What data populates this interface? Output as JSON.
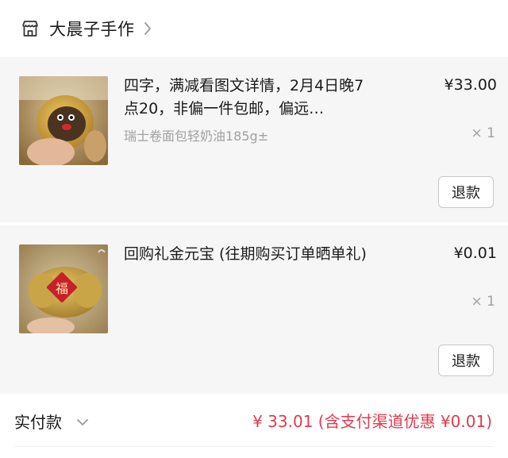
{
  "shop": {
    "name": "大晨子手作"
  },
  "items": [
    {
      "title": "四字，满减看图文详情，2月4日晚7点20，非偏一件包邮，偏远…",
      "spec": "瑞士卷面包轻奶油185g±",
      "price": "¥33.00",
      "qty": "× 1",
      "refund_label": "退款"
    },
    {
      "title": "回购礼金元宝 (往期购买订单晒单礼)",
      "spec": "",
      "price": "¥0.01",
      "qty": "× 1",
      "refund_label": "退款"
    }
  ],
  "payment": {
    "label": "实付款",
    "amount": "¥ 33.01 (含支付渠道优惠 ¥0.01)",
    "accent_color": "#e23a4e"
  }
}
